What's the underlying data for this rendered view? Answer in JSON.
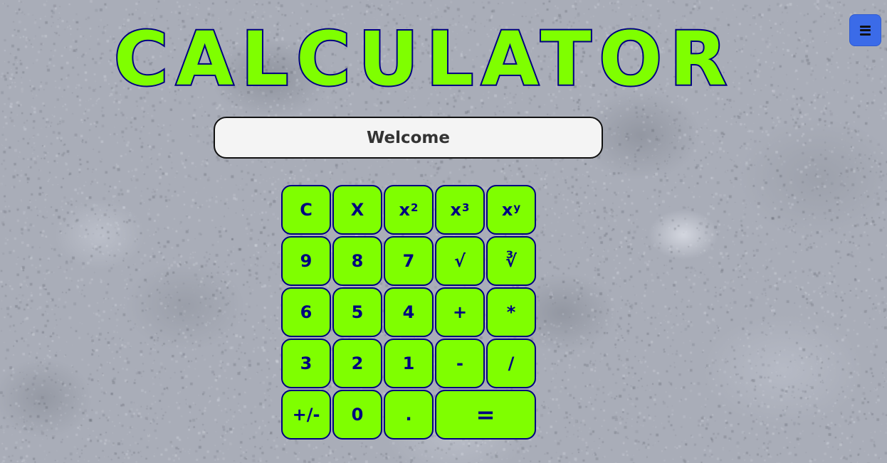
{
  "header": {
    "title": "CALCULATOR"
  },
  "menu": {
    "icon": "hamburger-menu-icon",
    "color": "#3b6be8"
  },
  "display": {
    "value": "Welcome"
  },
  "keypad": {
    "key_color": "#7fff00",
    "key_border_color": "#000080",
    "keys": {
      "clear": "C",
      "backspace": "X",
      "square_base": "x",
      "square_exp": "2",
      "cube_base": "x",
      "cube_exp": "3",
      "power_base": "x",
      "power_exp": "y",
      "nine": "9",
      "eight": "8",
      "seven": "7",
      "sqrt": "√",
      "cbrt": "∛",
      "six": "6",
      "five": "5",
      "four": "4",
      "plus": "+",
      "multiply": "*",
      "three": "3",
      "two": "2",
      "one": "1",
      "minus": "-",
      "divide": "/",
      "negate": "+/-",
      "zero": "0",
      "decimal": ".",
      "equals": "="
    }
  }
}
